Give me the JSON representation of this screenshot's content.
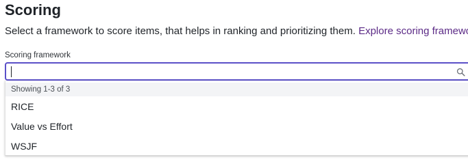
{
  "header": {
    "title": "Scoring",
    "description": "Select a framework to score items, that helps in ranking and prioritizing them.",
    "link_text": "Explore scoring frameworks"
  },
  "field": {
    "label": "Scoring framework",
    "value": "",
    "placeholder": "",
    "focus_color": "#5a4fc8",
    "icon": "search-icon"
  },
  "dropdown": {
    "status": "Showing 1-3 of 3",
    "options": [
      {
        "label": "RICE"
      },
      {
        "label": "Value vs Effort"
      },
      {
        "label": "WSJF"
      }
    ]
  },
  "colors": {
    "link": "#5b2a86",
    "text": "#1f2328",
    "status_bg": "#f3f4f6"
  }
}
